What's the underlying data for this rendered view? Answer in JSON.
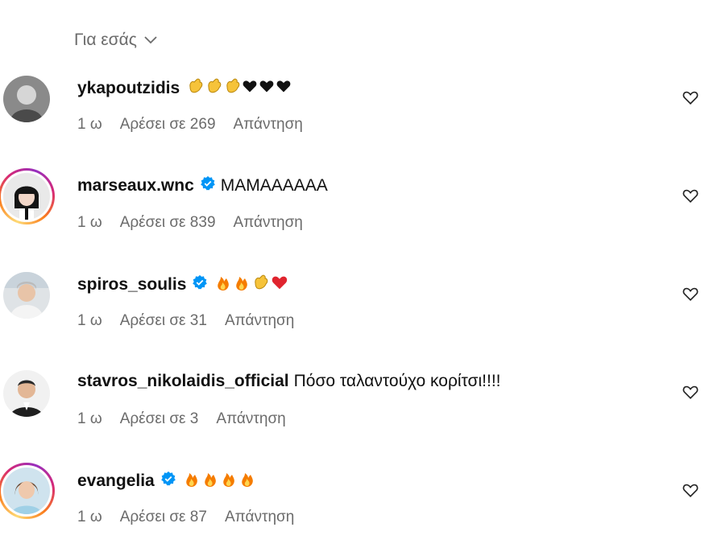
{
  "filter": {
    "label": "Για εσάς"
  },
  "comments": [
    {
      "username": "ykapoutzidis",
      "verified": false,
      "text": "",
      "emojis": [
        "clap",
        "clap",
        "clap",
        "black-heart",
        "black-heart",
        "black-heart"
      ],
      "time": "1 ω",
      "likes": "Αρέσει σε 269",
      "reply": "Απάντηση",
      "story_ring": false
    },
    {
      "username": "marseaux.wnc",
      "verified": true,
      "text": "MAMAAAAAA",
      "emojis": [],
      "time": "1 ω",
      "likes": "Αρέσει σε 839",
      "reply": "Απάντηση",
      "story_ring": true
    },
    {
      "username": "spiros_soulis",
      "verified": true,
      "text": "",
      "emojis": [
        "fire",
        "fire",
        "clap",
        "red-heart"
      ],
      "time": "1 ω",
      "likes": "Αρέσει σε 31",
      "reply": "Απάντηση",
      "story_ring": false
    },
    {
      "username": "stavros_nikolaidis_official",
      "verified": false,
      "text": "Πόσο ταλαντούχο κορίτσι!!!!",
      "emojis": [],
      "time": "1 ω",
      "likes": "Αρέσει σε 3",
      "reply": "Απάντηση",
      "story_ring": false
    },
    {
      "username": "evangelia",
      "verified": true,
      "text": "",
      "emojis": [
        "fire",
        "fire",
        "fire",
        "fire"
      ],
      "time": "1 ω",
      "likes": "Αρέσει σε 87",
      "reply": "Απάντηση",
      "story_ring": true
    }
  ],
  "colors": {
    "verified": "#0095f6",
    "muted": "#6b6b6b"
  }
}
